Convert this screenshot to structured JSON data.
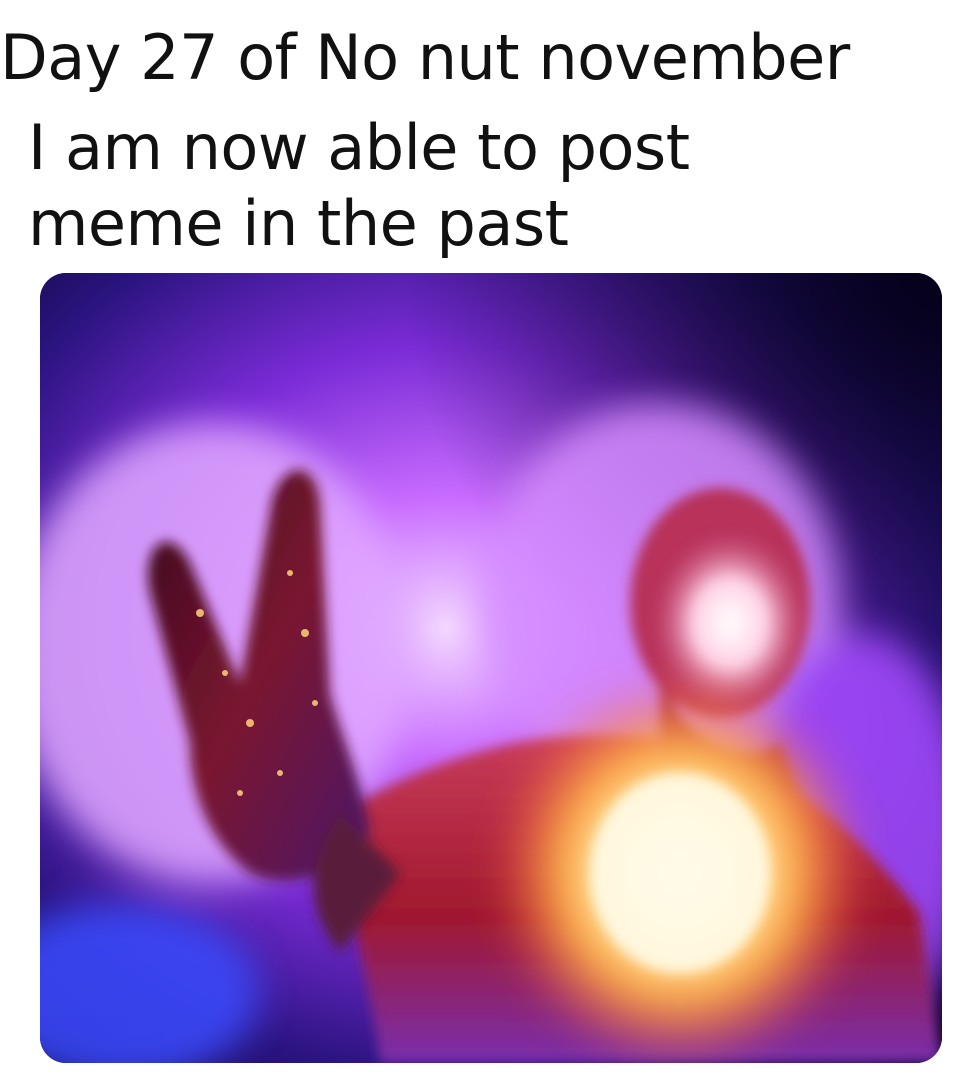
{
  "caption": {
    "line1": "Day 27 of No nut november",
    "line2": "I am now able to post",
    "line3": "meme in the past"
  },
  "image": {
    "subject": "glowing-cosmic-figure",
    "palette": {
      "background_dark": "#12063a",
      "aura_purple": "#9b3cff",
      "aura_violet": "#c86cff",
      "aura_blue": "#3a4cff",
      "body_red": "#a0182e",
      "chest_glow": "#fff6c8"
    }
  }
}
